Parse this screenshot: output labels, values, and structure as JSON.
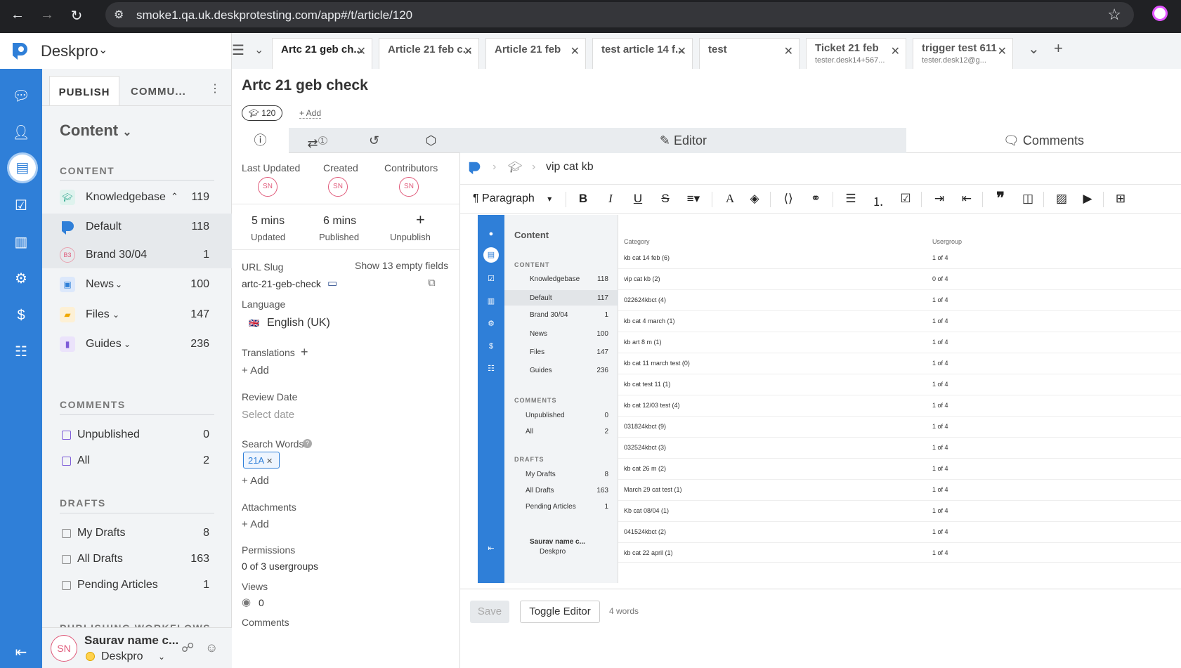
{
  "browser": {
    "url": "smoke1.qa.uk.deskprotesting.com/app#/t/article/120",
    "back_icon": "←",
    "forward_icon": "→",
    "reload_icon": "↻",
    "star_icon": "☆"
  },
  "app": {
    "brand": "Deskpro",
    "accent": "#2f7fd8"
  },
  "tabs": [
    {
      "title": "Artc 21 geb ch...",
      "sub": ""
    },
    {
      "title": "Article 21 feb c...",
      "sub": ""
    },
    {
      "title": "Article 21 feb",
      "sub": ""
    },
    {
      "title": "test article 14 f...",
      "sub": ""
    },
    {
      "title": "test",
      "sub": ""
    },
    {
      "title": "Ticket 21 feb",
      "sub": "tester.desk14+567..."
    },
    {
      "title": "trigger test 611",
      "sub": "tester.desk12@g..."
    }
  ],
  "sidebar": {
    "tab_publish": "PUBLISH",
    "tab_community": "COMMU...",
    "content_title": "Content",
    "section_content": "CONTENT",
    "items": [
      {
        "label": "Knowledgebase",
        "count": "119"
      },
      {
        "label": "Default",
        "count": "118"
      },
      {
        "label": "Brand 30/04",
        "count": "1"
      },
      {
        "label": "News",
        "count": "100"
      },
      {
        "label": "Files",
        "count": "147"
      },
      {
        "label": "Guides",
        "count": "236"
      }
    ],
    "brand_badge": "B3",
    "section_comments": "COMMENTS",
    "comments": [
      {
        "label": "Unpublished",
        "count": "0"
      },
      {
        "label": "All",
        "count": "2"
      }
    ],
    "section_drafts": "DRAFTS",
    "drafts": [
      {
        "label": "My Drafts",
        "count": "8"
      },
      {
        "label": "All Drafts",
        "count": "163"
      },
      {
        "label": "Pending Articles",
        "count": "1"
      }
    ],
    "section_workflows": "PUBLISHING WORKFLOWS",
    "user": {
      "initials": "SN",
      "name": "Saurav name c...",
      "org": "Deskpro"
    }
  },
  "article": {
    "title": "Artc 21 geb check",
    "id": "120",
    "add_label": "+ Add",
    "props_tab_badge": "1",
    "last_updated_label": "Last Updated",
    "created_label": "Created",
    "contributors_label": "Contributors",
    "initials": "SN",
    "updated_value": "5 mins",
    "updated_label": "Updated",
    "published_value": "6 mins",
    "published_label": "Published",
    "unpublish_label": "Unpublish",
    "url_slug_label": "URL Slug",
    "show_empty": "Show 13 empty fields",
    "url_slug": "artc-21-geb-check",
    "language_label": "Language",
    "language": "English (UK)",
    "translations_label": "Translations",
    "add": "Add",
    "review_date_label": "Review Date",
    "review_placeholder": "Select date",
    "search_words_label": "Search Words",
    "search_word_tag": "21A",
    "attachments_label": "Attachments",
    "permissions_label": "Permissions",
    "permissions_value": "0 of 3 usergroups",
    "views_label": "Views",
    "views_value": "0",
    "comments_label": "Comments"
  },
  "editor": {
    "tab_editor": "Editor",
    "tab_comments": "Comments",
    "breadcrumb_last": "vip cat kb",
    "paragraph": "Paragraph",
    "save": "Save",
    "toggle": "Toggle Editor",
    "words": "4 words"
  },
  "embedded": {
    "content_title": "Content",
    "section_content": "CONTENT",
    "items": [
      {
        "label": "Knowledgebase",
        "count": "118"
      },
      {
        "label": "Default",
        "count": "117"
      },
      {
        "label": "Brand 30/04",
        "count": "1"
      },
      {
        "label": "News",
        "count": "100"
      },
      {
        "label": "Files",
        "count": "147"
      },
      {
        "label": "Guides",
        "count": "236"
      }
    ],
    "section_comments": "COMMENTS",
    "comments": [
      {
        "label": "Unpublished",
        "count": "0"
      },
      {
        "label": "All",
        "count": "2"
      }
    ],
    "section_drafts": "DRAFTS",
    "drafts": [
      {
        "label": "My Drafts",
        "count": "8"
      },
      {
        "label": "All Drafts",
        "count": "163"
      },
      {
        "label": "Pending Articles",
        "count": "1"
      }
    ],
    "user_name": "Saurav name c...",
    "user_org": "Deskpro",
    "col_category": "Category",
    "col_usergroup": "Usergroup",
    "rows": [
      {
        "category": "kb cat 14 feb (6)",
        "usergroup": "1 of 4"
      },
      {
        "category": "vip cat kb (2)",
        "usergroup": "0 of 4"
      },
      {
        "category": "022624kbct (4)",
        "usergroup": "1 of 4"
      },
      {
        "category": "kb cat 4 march (1)",
        "usergroup": "1 of 4"
      },
      {
        "category": "kb art 8 m (1)",
        "usergroup": "1 of 4"
      },
      {
        "category": "kb cat 11 march test (0)",
        "usergroup": "1 of 4"
      },
      {
        "category": "kb cat test 11 (1)",
        "usergroup": "1 of 4"
      },
      {
        "category": "kb cat 12/03 test (4)",
        "usergroup": "1 of 4"
      },
      {
        "category": "031824kbct (9)",
        "usergroup": "1 of 4"
      },
      {
        "category": "032524kbct (3)",
        "usergroup": "1 of 4"
      },
      {
        "category": "kb cat 26 m (2)",
        "usergroup": "1 of 4"
      },
      {
        "category": "March 29 cat test (1)",
        "usergroup": "1 of 4"
      },
      {
        "category": "Kb cat 08/04 (1)",
        "usergroup": "1 of 4"
      },
      {
        "category": "041524kbct (2)",
        "usergroup": "1 of 4"
      },
      {
        "category": "kb cat 22 april (1)",
        "usergroup": "1 of 4"
      }
    ]
  }
}
